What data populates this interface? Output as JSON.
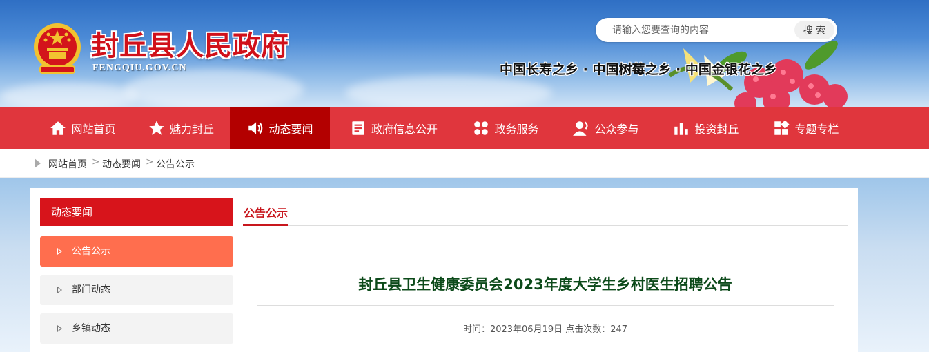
{
  "header": {
    "title": "封丘县人民政府",
    "domain": "FENGQIU.GOV.CN",
    "slogan": "中国长寿之乡 · 中国树莓之乡 · 中国金银花之乡",
    "search": {
      "placeholder": "请输入您要查询的内容",
      "button": "搜 索"
    }
  },
  "nav": {
    "items": [
      {
        "label": "网站首页",
        "icon": "home-icon"
      },
      {
        "label": "魅力封丘",
        "icon": "star-icon"
      },
      {
        "label": "动态要闻",
        "icon": "speaker-icon",
        "active": true
      },
      {
        "label": "政府信息公开",
        "icon": "document-icon"
      },
      {
        "label": "政务服务",
        "icon": "people-icon"
      },
      {
        "label": "公众参与",
        "icon": "user-chat-icon"
      },
      {
        "label": "投资封丘",
        "icon": "bar-chart-icon"
      },
      {
        "label": "专题专栏",
        "icon": "grid-icon"
      }
    ]
  },
  "breadcrumb": {
    "items": [
      "网站首页",
      "动态要闻",
      "公告公示"
    ],
    "separator": ">"
  },
  "sidebar": {
    "heading": "动态要闻",
    "items": [
      {
        "label": "公告公示",
        "active": true
      },
      {
        "label": "部门动态"
      },
      {
        "label": "乡镇动态"
      }
    ]
  },
  "content": {
    "tab": "公告公示",
    "article": {
      "title": "封丘县卫生健康委员会2023年度大学生乡村医生招聘公告",
      "meta": "时间：2023年06月19日 点击次数：247"
    }
  },
  "colors": {
    "nav": "#e0363d",
    "nav_active": "#b30000",
    "brand_red": "#d7141b",
    "sidebar_active": "#ff6e4e",
    "title_green": "#0c4a1a"
  }
}
